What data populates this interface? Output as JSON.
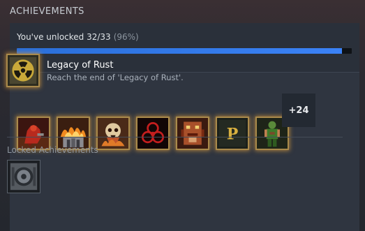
{
  "header": {
    "title": "ACHIEVEMENTS"
  },
  "progress": {
    "label": "You've unlocked 32/33",
    "percent_label": "(96%)",
    "fraction": 0.97
  },
  "featured": {
    "title": "Legacy of Rust",
    "description": "Reach the end of 'Legacy of Rust'.",
    "icon": "radiation-icon"
  },
  "unlocked_row": {
    "icons": [
      "red-demon-icon",
      "burning-fortress-icon",
      "fire-skull-icon",
      "biohazard-icon",
      "demon-face-icon",
      "letter-p-icon",
      "marine-icon"
    ],
    "more_label": "+24"
  },
  "locked": {
    "label": "Locked Achievements",
    "icon": "vault-door-icon"
  },
  "colors": {
    "progress_fill": "#3b82f6",
    "glow": "#d2963c",
    "panel": "#2f3540"
  }
}
